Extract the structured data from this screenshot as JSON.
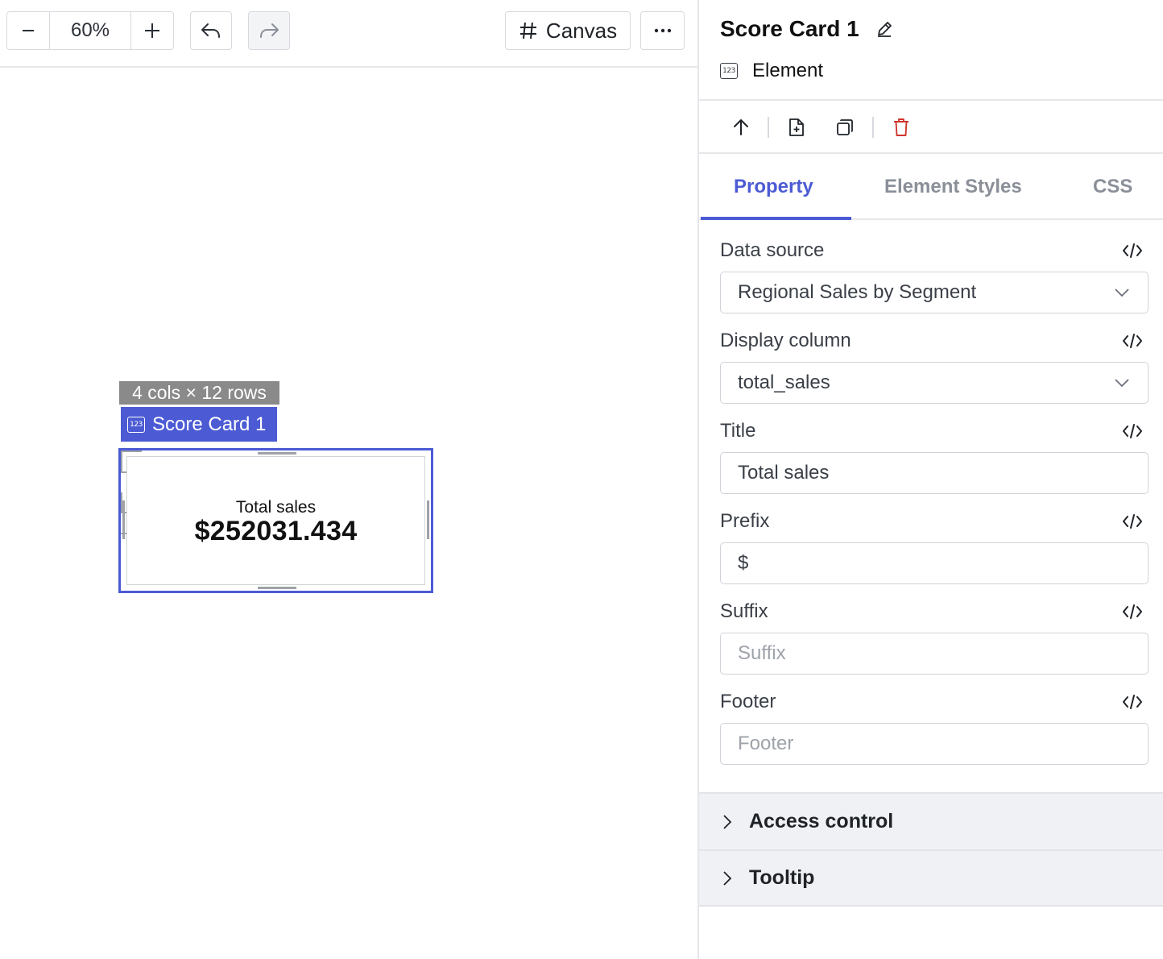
{
  "toolbar": {
    "zoom_value": "60%",
    "canvas_label": "Canvas"
  },
  "canvas": {
    "dimension_label": "4 cols × 12 rows",
    "element_badge": "Score Card 1",
    "icon_text": "123",
    "card": {
      "title": "Total sales",
      "value": "$252031.434"
    }
  },
  "panel": {
    "title": "Score Card 1",
    "type_label": "Element",
    "tabs": [
      {
        "label": "Property"
      },
      {
        "label": "Element Styles"
      },
      {
        "label": "CSS"
      }
    ],
    "fields": {
      "data_source": {
        "label": "Data source",
        "value": "Regional Sales by Segment"
      },
      "display_column": {
        "label": "Display column",
        "value": "total_sales"
      },
      "title": {
        "label": "Title",
        "value": "Total sales"
      },
      "prefix": {
        "label": "Prefix",
        "value": "$"
      },
      "suffix": {
        "label": "Suffix",
        "placeholder": "Suffix"
      },
      "footer": {
        "label": "Footer",
        "placeholder": "Footer"
      }
    },
    "sections": [
      {
        "label": "Access control"
      },
      {
        "label": "Tooltip"
      }
    ]
  },
  "colors": {
    "accent": "#4c5bd4",
    "danger": "#d0342c",
    "dimension_badge": "#8a8a8a"
  }
}
